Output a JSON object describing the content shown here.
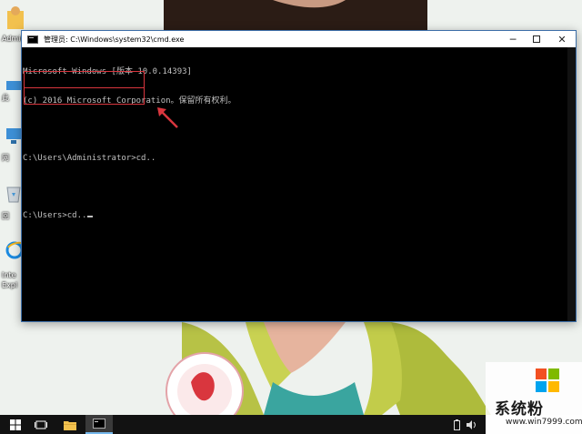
{
  "desktop": {
    "icons": [
      {
        "label": "Admin",
        "icon": "user-folder-icon"
      },
      {
        "label": "此",
        "icon": "this-pc-icon"
      },
      {
        "label": "网",
        "icon": "network-icon"
      },
      {
        "label": "回",
        "icon": "recycle-bin-icon"
      },
      {
        "label": "Inte",
        "label2": "Expl",
        "icon": "internet-explorer-icon"
      }
    ]
  },
  "window": {
    "title": "管理员: C:\\Windows\\system32\\cmd.exe",
    "minimize": "─",
    "close": "✕"
  },
  "console": {
    "lines": [
      "Microsoft Windows [版本 10.0.14393]",
      "(c) 2016 Microsoft Corporation。保留所有权利。",
      "",
      "C:\\Users\\Administrator>cd..",
      "",
      "C:\\Users>cd.."
    ]
  },
  "watermark": {
    "title": "系统粉",
    "url": "www.win7999.com",
    "colors": [
      "#f25022",
      "#7fba00",
      "#00a4ef",
      "#ffb900"
    ]
  },
  "taskbar": {
    "items": [
      "windows-start-icon",
      "task-view-icon",
      "file-explorer-icon",
      "cmd-taskbar-icon"
    ]
  },
  "colors": {
    "highlight": "#d9363e",
    "console_text": "#c0c0c0"
  }
}
